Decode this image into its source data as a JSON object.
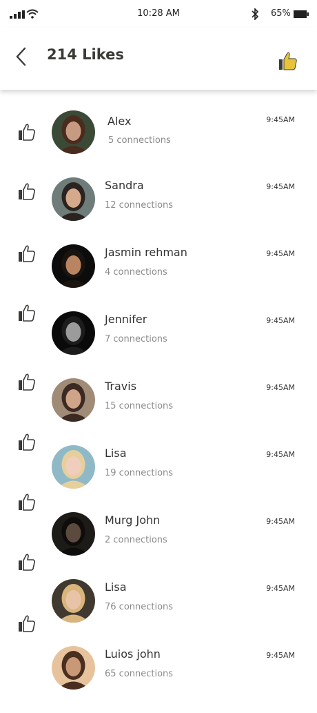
{
  "status": {
    "time": "10:28 AM",
    "battery": "65%"
  },
  "header": {
    "title": "214 Likes"
  },
  "colors": {
    "accent": "#e8c33a",
    "text": "#3a3a36",
    "muted": "#8a8a8a"
  },
  "likes": [
    {
      "name": "Alex",
      "connections": "5 connections",
      "time": "9:45AM",
      "avatar_bg": "#3b4a36",
      "skin": "#c79a82",
      "hair": "#4a2c1f"
    },
    {
      "name": "Sandra",
      "connections": "12 connections",
      "time": "9:45AM",
      "avatar_bg": "#6f7d7a",
      "skin": "#d4a98c",
      "hair": "#2a2320"
    },
    {
      "name": "Jasmin rehman",
      "connections": "4 connections",
      "time": "9:45AM",
      "avatar_bg": "#0c0c0c",
      "skin": "#b98461",
      "hair": "#1a1410"
    },
    {
      "name": "Jennifer",
      "connections": "7 connections",
      "time": "9:45AM",
      "avatar_bg": "#0a0a0a",
      "skin": "#9b9b9b",
      "hair": "#1c1c1c"
    },
    {
      "name": "Travis",
      "connections": "15 connections",
      "time": "9:45AM",
      "avatar_bg": "#a08b77",
      "skin": "#d0a489",
      "hair": "#3b2a22"
    },
    {
      "name": "Lisa",
      "connections": "19 connections",
      "time": "9:45AM",
      "avatar_bg": "#8fb9c6",
      "skin": "#f0cdbd",
      "hair": "#e7cf9c"
    },
    {
      "name": "Murg John",
      "connections": "2 connections",
      "time": "9:45AM",
      "avatar_bg": "#1d1b18",
      "skin": "#5b4a3d",
      "hair": "#0f0d0b"
    },
    {
      "name": "Lisa",
      "connections": "76 connections",
      "time": "9:45AM",
      "avatar_bg": "#40392f",
      "skin": "#e9c3a8",
      "hair": "#d9b57c"
    },
    {
      "name": "Luios john",
      "connections": "65 connections",
      "time": "9:45AM",
      "avatar_bg": "#e7c39d",
      "skin": "#c89877",
      "hair": "#4a2f20"
    }
  ]
}
